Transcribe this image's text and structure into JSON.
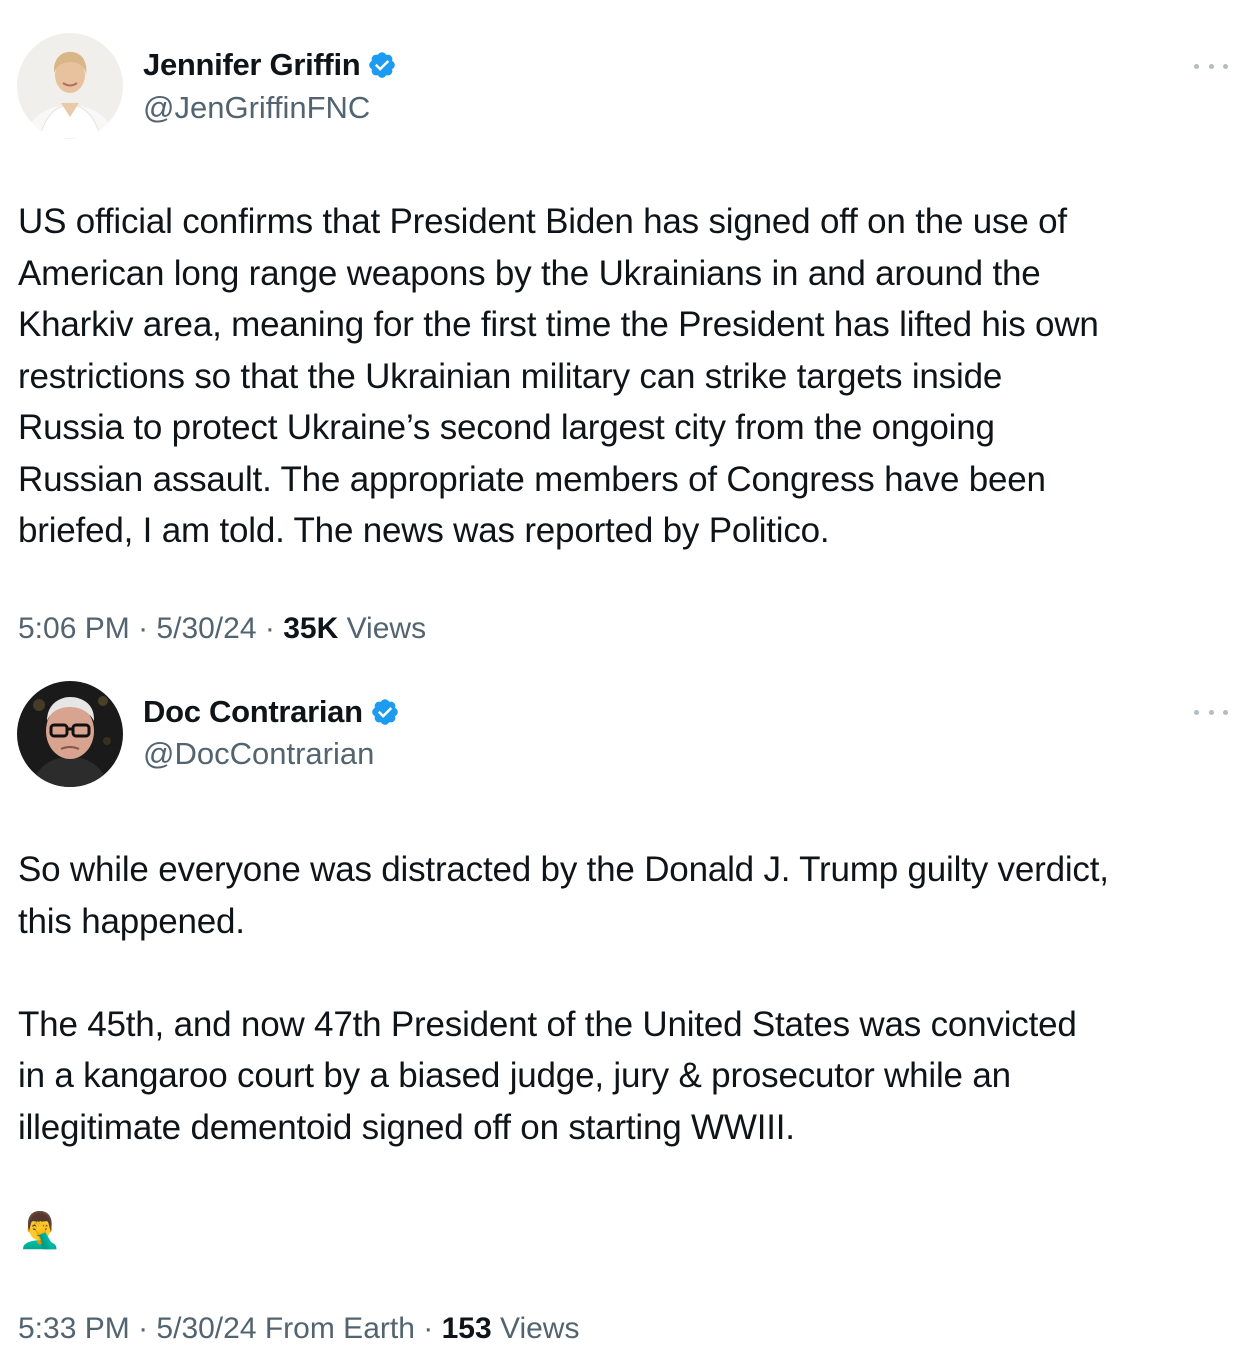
{
  "tweets": [
    {
      "author": {
        "display_name": "Jennifer Griffin",
        "handle": "@JenGriffinFNC",
        "verified": true,
        "avatar_icon": "avatar-photo-woman"
      },
      "text": "US official confirms that President Biden has signed off on the use of\nAmerican long range weapons by the Ukrainians in and around the\nKharkiv area, meaning for the first time the President has lifted his own\nrestrictions so that the Ukrainian military can strike targets inside\nRussia to protect Ukraine’s second largest city from the ongoing\nRussian assault. The appropriate members of Congress have been\nbriefed, I am told. The news was reported by Politico.",
      "time": "5:06 PM",
      "date": "5/30/24",
      "source": "",
      "views_count": "35K",
      "views_label": "Views"
    },
    {
      "author": {
        "display_name": "Doc Contrarian",
        "handle": "@DocContrarian",
        "verified": true,
        "avatar_icon": "avatar-photo-man"
      },
      "text": "So while everyone was distracted by the Donald J. Trump guilty verdict,\nthis happened.\n\nThe 45th, and now 47th President of the United States was convicted\nin a kangaroo court by a biased judge, jury & prosecutor while an\nillegitimate dementoid signed off on starting WWIII.\n\n",
      "emoji": "🤦‍♂️",
      "time": "5:33 PM",
      "date": "5/30/24",
      "source": "From Earth",
      "views_count": "153",
      "views_label": "Views"
    }
  ],
  "colors": {
    "text_primary": "#0f1419",
    "text_secondary": "#536471",
    "verified_blue": "#1d9bf0"
  },
  "icons": {
    "verified": "verified-badge-icon",
    "more": "more-options-icon",
    "separator": "·"
  }
}
